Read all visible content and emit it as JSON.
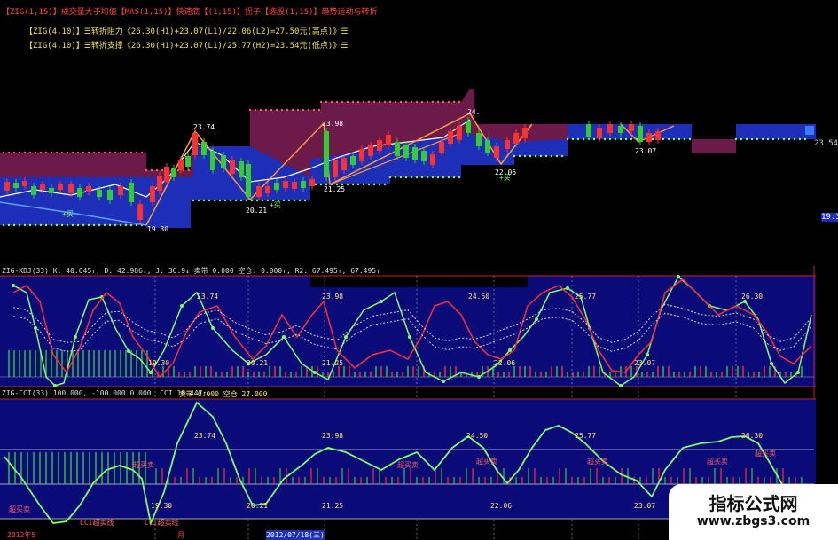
{
  "header": {
    "indicator_strip": "【ZIG(1,15)】成交量大于均值【MA5(1,15)】快速底【(1,15)】拐子【选股(1,15)】趋势运动与转折",
    "zig_resist_label": "【ZIG(4,10)】☰转折阻力《26.30(H1)+23.07(L1)/22.06(L2)=27.50元(高点)》☰",
    "zig_support_label": "【ZIG(4,10)】☰转折支撑《26.30(H1)+23.07(L1)/25.77(H2)=23.54元(低点)》☰"
  },
  "main_pane": {
    "price_labels": [
      {
        "text": "19.30",
        "x": 0
      },
      {
        "text": "23.74",
        "x": 0
      },
      {
        "text": "20.21",
        "x": 0
      },
      {
        "text": "23.98",
        "x": 0
      },
      {
        "text": "21.25",
        "x": 0
      },
      {
        "text": "24.",
        "x": 0
      },
      {
        "text": "22.06",
        "x": 0
      },
      {
        "text": "23.07",
        "x": 0
      }
    ],
    "buy_labels": [
      "+买",
      "+买",
      "+买"
    ],
    "right_axis": [
      "23.54",
      "19.3"
    ]
  },
  "kdj_pane": {
    "title": "ZIG-KDJ(33) K: 40.645↑, D: 42.986↓, J: 36.9↓ 卖带 0.000 空仓: 0.000↑, R2: 67.495↑, 67.495↑",
    "tags": [
      "23.74",
      "19.30",
      "20.21",
      "23.98",
      "21.25",
      "24.50",
      "22.06",
      "25.77",
      "23.07",
      "26.30"
    ]
  },
  "cci_pane": {
    "title": "ZIG-CCI(33) 100.000, -100.000 0.000, CCI 16.447↑,",
    "title_extra": "卖带 0.000 空仓 27.000",
    "tags": [
      "23.74",
      "19.30",
      "20.21",
      "23.98",
      "21.25",
      "24.50",
      "22.06",
      "25.77",
      "23.07",
      "26.30"
    ],
    "notes": [
      "超买卖",
      "超买卖",
      "超买卖",
      "超买卖",
      "超买卖",
      "超买卖",
      "超买卖",
      "超买卖"
    ],
    "bottom_notes": [
      "CCI超卖线",
      "CCI超卖线"
    ]
  },
  "date_axis": {
    "labels": [
      "2012年5",
      "月",
      "2012/07/18(三)"
    ]
  },
  "watermark": {
    "line1": "指标公式网",
    "line2": "www.zbgs3.com"
  },
  "colors": {
    "up": "#ff3030",
    "down": "#33cc33",
    "band_top": "#6b1a4a",
    "band_bottom": "#1d2fb8",
    "pane_bg": "#0a0a78",
    "zig": "#ff9b3b",
    "k_line": "#7fff6b",
    "d_line": "#ff3030"
  }
}
